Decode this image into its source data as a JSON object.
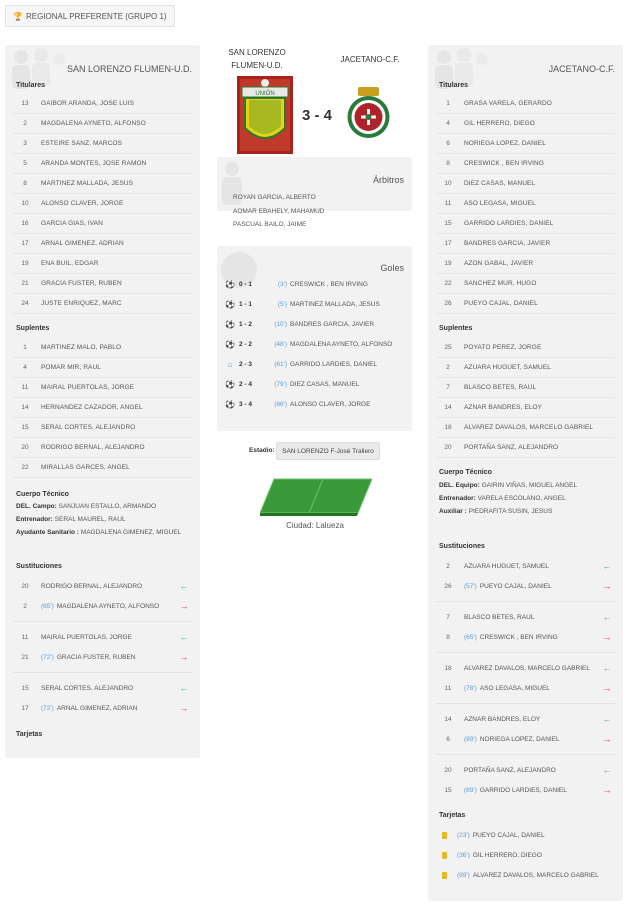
{
  "competition": {
    "label": "REGIONAL PREFERENTE (GRUPO 1)",
    "icon": "trophy-icon"
  },
  "home": {
    "name": "SAN LORENZO FLUMEN-U.D.",
    "name_line1": "SAN LORENZO",
    "name_line2": "FLUMEN-U.D.",
    "crest_text": "UNIÓN",
    "starters_title": "Titulares",
    "starters": [
      {
        "num": "13",
        "name": "GAIBOR ARANDA, JOSE LUIS"
      },
      {
        "num": "2",
        "name": "MAGDALENA AYNETO, ALFONSO"
      },
      {
        "num": "3",
        "name": "ESTEIRE SANZ, MARCOS"
      },
      {
        "num": "5",
        "name": "ARANDA MONTES, JOSE RAMON"
      },
      {
        "num": "8",
        "name": "MARTINEZ MALLADA, JESUS"
      },
      {
        "num": "10",
        "name": "ALONSO CLAVER, JORGE"
      },
      {
        "num": "16",
        "name": "GARCIA GIAS, IVAN"
      },
      {
        "num": "17",
        "name": "ARNAL GIMENEZ, ADRIAN"
      },
      {
        "num": "19",
        "name": "ENA BUIL, EDGAR"
      },
      {
        "num": "21",
        "name": "GRACIA FUSTER, RUBEN"
      },
      {
        "num": "24",
        "name": "JUSTE ENRIQUEZ, MARC"
      }
    ],
    "subs_title": "Suplentes",
    "subs": [
      {
        "num": "1",
        "name": "MARTINEZ MALO, PABLO"
      },
      {
        "num": "4",
        "name": "POMAR MIR, RAUL"
      },
      {
        "num": "11",
        "name": "MAIRAL PUERTOLAS, JORGE"
      },
      {
        "num": "14",
        "name": "HERNANDEZ CAZADOR, ANGEL"
      },
      {
        "num": "15",
        "name": "SERAL CORTES, ALEJANDRO"
      },
      {
        "num": "20",
        "name": "RODRIGO BERNAL, ALEJANDRO"
      },
      {
        "num": "22",
        "name": "MIRALLAS GARCES, ANGEL"
      }
    ],
    "staff_title": "Cuerpo Técnico",
    "staff": [
      {
        "role": "DEL. Campo:",
        "name": "SANJUAN ESTALLO, ARMANDO"
      },
      {
        "role": "Entrenador:",
        "name": "SERAL MAUREL, RAUL"
      },
      {
        "role": "Ayudante Sanitario :",
        "name": "MAGDALENA GIMENEZ, MIGUEL"
      }
    ],
    "changes_title": "Sustituciones",
    "changes": [
      {
        "num": "20",
        "min": "",
        "name": "RODRIGO BERNAL, ALEJANDRO",
        "dir": "in",
        "arrow": "←"
      },
      {
        "num": "2",
        "min": "(65')",
        "name": "MAGDALENA AYNETO, ALFONSO",
        "dir": "out",
        "arrow": "→"
      },
      {
        "num": "11",
        "min": "",
        "name": "MAIRAL PUERTOLAS, JORGE",
        "dir": "in",
        "arrow": "←"
      },
      {
        "num": "21",
        "min": "(72')",
        "name": "GRACIA FUSTER, RUBEN",
        "dir": "out",
        "arrow": "→"
      },
      {
        "num": "15",
        "min": "",
        "name": "SERAL CORTES, ALEJANDRO",
        "dir": "in",
        "arrow": "←"
      },
      {
        "num": "17",
        "min": "(72')",
        "name": "ARNAL GIMENEZ, ADRIAN",
        "dir": "out",
        "arrow": "→"
      }
    ],
    "cards_title": "Tarjetas"
  },
  "away": {
    "name": "JACETANO-C.F.",
    "starters_title": "Titulares",
    "starters": [
      {
        "num": "1",
        "name": "GRASA VARELA, GERARDO"
      },
      {
        "num": "4",
        "name": "GIL HERRERO, DIEGO"
      },
      {
        "num": "6",
        "name": "NORIEGA LOPEZ, DANIEL"
      },
      {
        "num": "8",
        "name": "CRESWICK , BEN IRVING"
      },
      {
        "num": "10",
        "name": "DIEZ CASAS, MANUEL"
      },
      {
        "num": "11",
        "name": "ASO LEGASA, MIGUEL"
      },
      {
        "num": "15",
        "name": "GARRIDO LARDIES, DANIEL"
      },
      {
        "num": "17",
        "name": "BANDRES GARCIA, JAVIER"
      },
      {
        "num": "19",
        "name": "AZON GABAL, JAVIER"
      },
      {
        "num": "22",
        "name": "SANCHEZ MUR, HUGO"
      },
      {
        "num": "26",
        "name": "PUEYO CAJAL, DANIEL"
      }
    ],
    "subs_title": "Suplentes",
    "subs": [
      {
        "num": "25",
        "name": "POYATO PEREZ, JORGE"
      },
      {
        "num": "2",
        "name": "AZUARA HUGUET, SAMUEL"
      },
      {
        "num": "7",
        "name": "BLASCO BETES, RAUL"
      },
      {
        "num": "14",
        "name": "AZNAR BANDRES, ELOY"
      },
      {
        "num": "18",
        "name": "ALVAREZ DAVALOS, MARCELO GABRIEL"
      },
      {
        "num": "20",
        "name": "PORTAÑA SANZ, ALEJANDRO"
      }
    ],
    "staff_title": "Cuerpo Técnico",
    "staff": [
      {
        "role": "DEL. Equipo:",
        "name": "GAIRIN VIÑAS, MIGUEL ANGEL"
      },
      {
        "role": "Entrenador:",
        "name": "VARELA ESCOLANO, ANGEL"
      },
      {
        "role": "Auxiliar :",
        "name": "PIEDRAFITA SUSIN, JESUS"
      }
    ],
    "changes_title": "Sustituciones",
    "changes": [
      {
        "num": "2",
        "min": "",
        "name": "AZUARA HUGUET, SAMUEL",
        "dir": "in",
        "arrow": "←"
      },
      {
        "num": "26",
        "min": "(57')",
        "name": "PUEYO CAJAL, DANIEL",
        "dir": "out",
        "arrow": "→"
      },
      {
        "num": "7",
        "min": "",
        "name": "BLASCO BETES, RAUL",
        "dir": "in",
        "arrow": "←"
      },
      {
        "num": "8",
        "min": "(65')",
        "name": "CRESWICK , BEN IRVING",
        "dir": "out",
        "arrow": "→"
      },
      {
        "num": "18",
        "min": "",
        "name": "ALVAREZ DAVALOS, MARCELO GABRIEL",
        "dir": "in",
        "arrow": "←"
      },
      {
        "num": "11",
        "min": "(78')",
        "name": "ASO LEGASA, MIGUEL",
        "dir": "out",
        "arrow": "→"
      },
      {
        "num": "14",
        "min": "",
        "name": "AZNAR BANDRES, ELOY",
        "dir": "in",
        "arrow": "←"
      },
      {
        "num": "6",
        "min": "(89')",
        "name": "NORIEGA LOPEZ, DANIEL",
        "dir": "out",
        "arrow": "→"
      },
      {
        "num": "20",
        "min": "",
        "name": "PORTAÑA SANZ, ALEJANDRO",
        "dir": "in",
        "arrow": "←"
      },
      {
        "num": "15",
        "min": "(89')",
        "name": "GARRIDO LARDIES, DANIEL",
        "dir": "out",
        "arrow": "→"
      }
    ],
    "cards_title": "Tarjetas",
    "cards": [
      {
        "min": "(23')",
        "name": "PUEYO CAJAL, DANIEL"
      },
      {
        "min": "(36')",
        "name": "GIL HERRERO, DIEGO"
      },
      {
        "min": "(89')",
        "name": "ALVAREZ DAVALOS, MARCELO GABRIEL"
      }
    ]
  },
  "score": "3 - 4",
  "referees": {
    "title": "Árbitros",
    "names": [
      "ROYAN GARCIA, ALBERTO",
      "AOMAR EBAHELY, MAHAMUD",
      "PASCUAL BAILO, JAIME"
    ]
  },
  "goals": {
    "title": "Goles",
    "items": [
      {
        "icon": "ball-icon",
        "score": "0 - 1",
        "min": "(3')",
        "name": "CRESWICK , BEN IRVING"
      },
      {
        "icon": "ball-icon",
        "score": "1 - 1",
        "min": "(5')",
        "name": "MARTINEZ MALLADA, JESUS"
      },
      {
        "icon": "ball-icon",
        "score": "1 - 2",
        "min": "(10')",
        "name": "BANDRES GARCIA, JAVIER"
      },
      {
        "icon": "ball-icon",
        "score": "2 - 2",
        "min": "(48')",
        "name": "MAGDALENA AYNETO, ALFONSO"
      },
      {
        "icon": "goal-net-icon",
        "score": "2 - 3",
        "min": "(61')",
        "name": "GARRIDO LARDIES, DANIEL"
      },
      {
        "icon": "ball-icon",
        "score": "2 - 4",
        "min": "(79')",
        "name": "DIEZ CASAS, MANUEL"
      },
      {
        "icon": "ball-icon",
        "score": "3 - 4",
        "min": "(86')",
        "name": "ALONSO CLAVER, JORGE"
      }
    ]
  },
  "stadium": {
    "label": "Estadio:",
    "name": "SAN LORENZO F-José Trallero"
  },
  "city": "Ciudad: Lalueza",
  "colors": {
    "panel": "#f2f2f2",
    "minute": "#5b9bd5",
    "in": "#3cb371",
    "out": "#e23b3b",
    "card": "#e8b923",
    "field": "#3a9a3a"
  }
}
